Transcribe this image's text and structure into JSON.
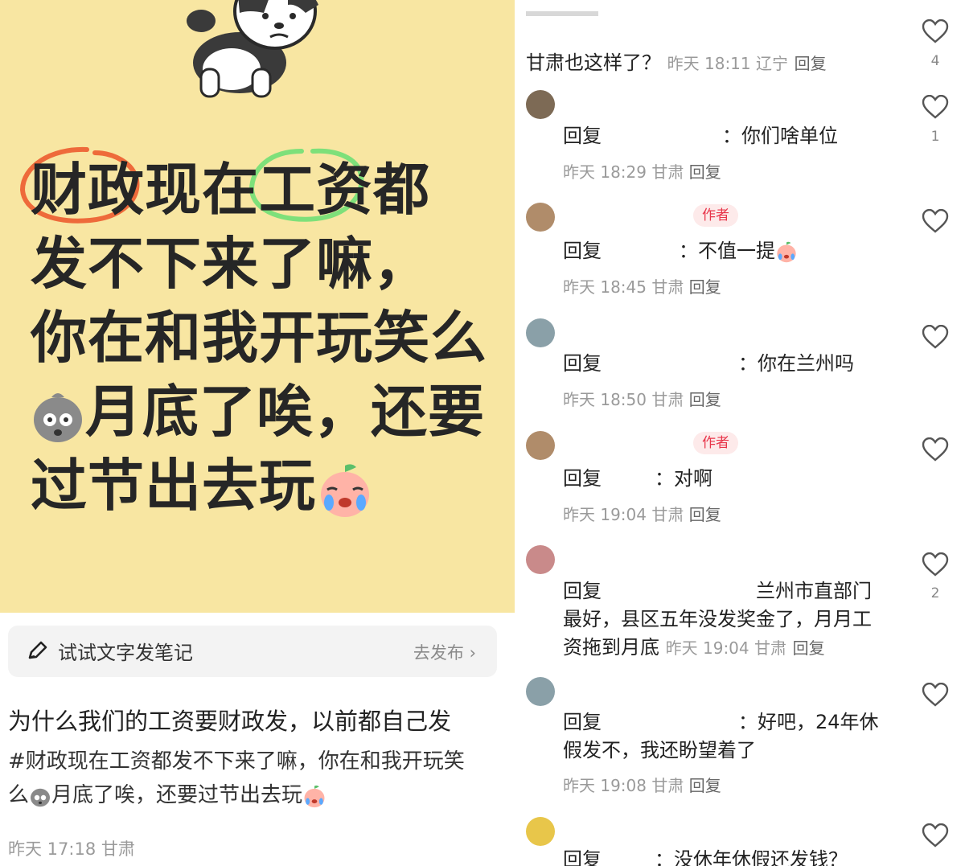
{
  "poster": {
    "lines": [
      "财政现在工资都",
      "发不下来了嘛，",
      "你在和我开玩笑么",
      "月底了唉，还要",
      "过节出去玩"
    ],
    "mascot_icon": "cartoon-dog-icon"
  },
  "note_bar": {
    "icon": "pencil-icon",
    "label": "试试文字发笔记",
    "action": "去发布"
  },
  "post": {
    "title": "为什么我们的工资要财政发，以前都自己发",
    "body_part1": "#财政现在工资都发不下来了嘛，你在和我开玩笑",
    "body_part2": "么",
    "body_part3": "月底了唉，还要过节出去玩",
    "meta": "昨天 17:18 甘肃"
  },
  "comments": {
    "top": {
      "text": "甘肃也这样了？",
      "meta": "昨天 18:11 辽宁",
      "reply": "回复",
      "likes": "4"
    },
    "items": [
      {
        "tag": "",
        "prefix": "回复",
        "text": "你们啥单位",
        "meta": "昨天 18:29 甘肃",
        "reply": "回复",
        "likes": "1"
      },
      {
        "tag": "作者",
        "prefix": "回复",
        "text": "不值一提",
        "meta": "昨天 18:45 甘肃",
        "reply": "回复",
        "likes": ""
      },
      {
        "tag": "",
        "prefix": "回复",
        "text": "你在兰州吗",
        "meta": "昨天 18:50 甘肃",
        "reply": "回复",
        "likes": ""
      },
      {
        "tag": "作者",
        "prefix": "回复",
        "text": "对啊",
        "meta": "昨天 19:04 甘肃",
        "reply": "回复",
        "likes": ""
      },
      {
        "tag": "",
        "prefix": "回复",
        "text_l1": "兰州市直部门",
        "text_l2": "最好，县区五年没发奖金了，月月工",
        "text_l3": "资拖到月底",
        "meta": "昨天 19:04 甘肃",
        "reply": "回复",
        "likes": "2"
      },
      {
        "tag": "",
        "prefix": "回复",
        "text_l1": "好吧，24年休",
        "text_l2": "假发不，我还盼望着了",
        "meta": "昨天 19:08 甘肃",
        "reply": "回复",
        "likes": ""
      },
      {
        "tag": "",
        "prefix": "回复",
        "text": "没休年休假还发钱？",
        "meta": "",
        "reply": "",
        "likes": ""
      }
    ]
  },
  "colors": {
    "poster_bg": "#f8e6a2",
    "author_tag": "#e8354a",
    "meta_gray": "#9a9a9a"
  }
}
